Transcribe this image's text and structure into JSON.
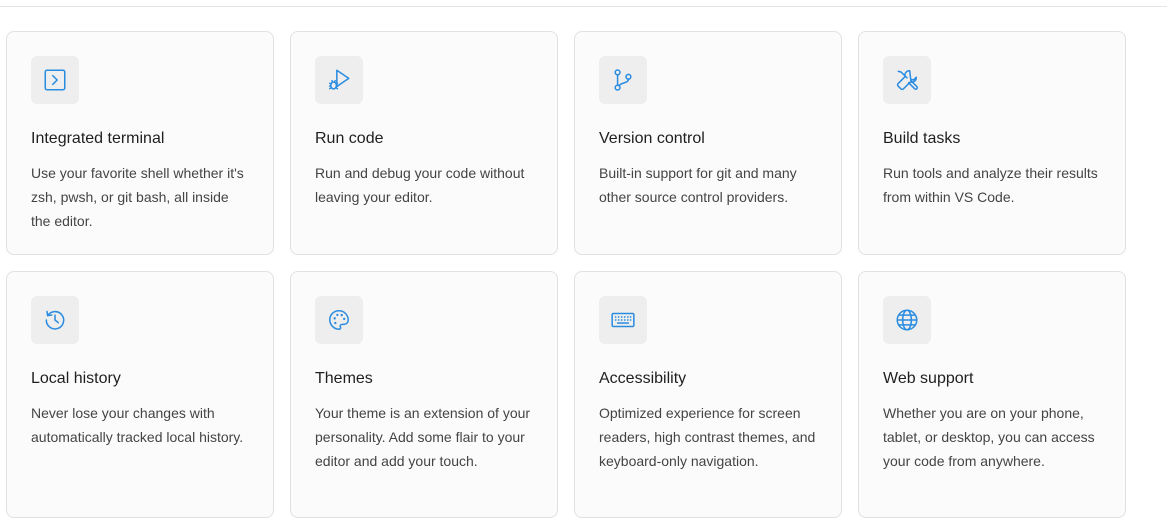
{
  "features": [
    {
      "icon": "terminal-icon",
      "title": "Integrated terminal",
      "description": "Use your favorite shell whether it's zsh, pwsh, or git bash, all inside the editor."
    },
    {
      "icon": "run-debug-icon",
      "title": "Run code",
      "description": "Run and debug your code without leaving your editor."
    },
    {
      "icon": "source-control-icon",
      "title": "Version control",
      "description": "Built-in support for git and many other source control providers."
    },
    {
      "icon": "tools-icon",
      "title": "Build tasks",
      "description": "Run tools and analyze their results from within VS Code."
    },
    {
      "icon": "history-icon",
      "title": "Local history",
      "description": "Never lose your changes with automatically tracked local history."
    },
    {
      "icon": "palette-icon",
      "title": "Themes",
      "description": "Your theme is an extension of your personality. Add some flair to your editor and add your touch."
    },
    {
      "icon": "keyboard-icon",
      "title": "Accessibility",
      "description": "Optimized experience for screen readers, high contrast themes, and keyboard-only navigation."
    },
    {
      "icon": "globe-icon",
      "title": "Web support",
      "description": "Whether you are on your phone, tablet, or desktop, you can access your code from anywhere."
    }
  ],
  "colors": {
    "accent": "#2b8ce0",
    "card_bg": "#fbfbfb",
    "card_border": "#e1e1e1",
    "icon_bg": "#eeeeee"
  }
}
